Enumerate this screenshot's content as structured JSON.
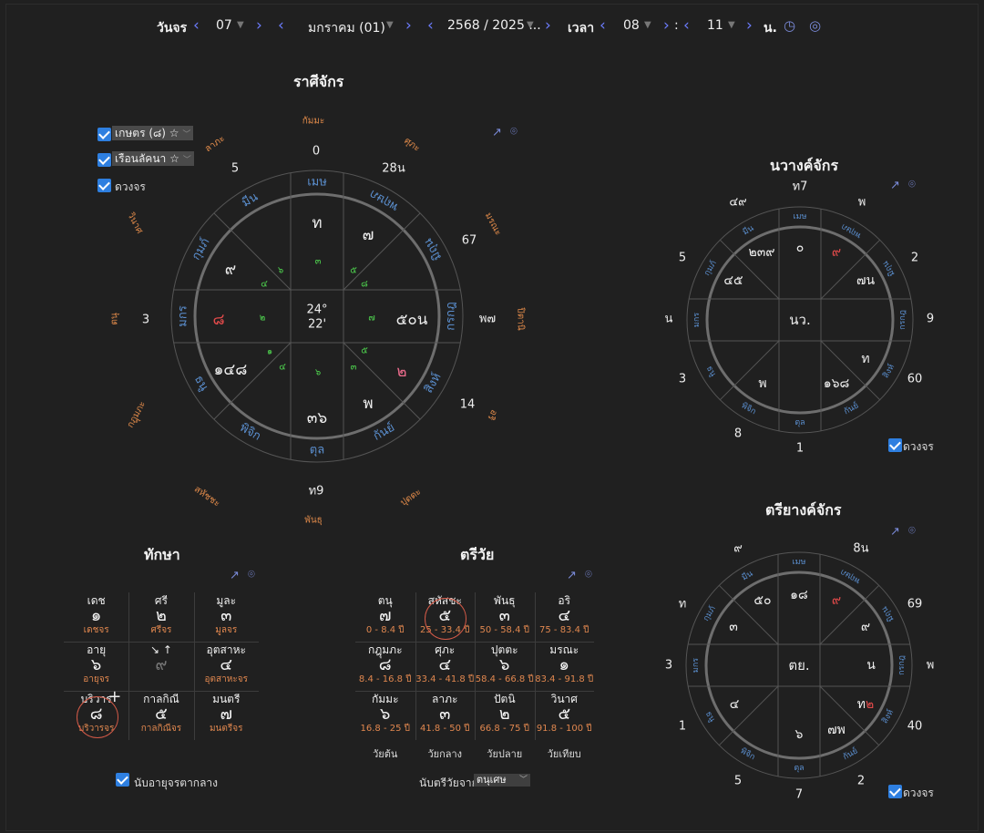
{
  "topbar": {
    "day_label": "วันจร",
    "day": "07",
    "month": "มกราคม (01)",
    "year": "2568 / 2025 ...",
    "time_label": "เวลา",
    "hour": "08",
    "colon": ":",
    "minute": "11",
    "unit": "น."
  },
  "rasi": {
    "title": "ราศีจักร",
    "checks": [
      {
        "label": "เกษตร (๘) ☆",
        "checked": true
      },
      {
        "label": "เรือนลัคนา ☆",
        "checked": true
      },
      {
        "label": "ดวงจร",
        "checked": true
      }
    ],
    "center": [
      "24°",
      "22'"
    ],
    "outer_labels": [
      "กัมมะ",
      "ศุภะ",
      "มรณะ",
      "ปิตานิ",
      "อริ",
      "ปุตตะ",
      "พันธุ",
      "สหัชชะ",
      "กฎุมภะ",
      "ตนุ",
      "วินาศ",
      "ลาภะ"
    ],
    "outer_numbers": [
      "0",
      "28น",
      "67",
      "พ๗",
      "14",
      "ท9",
      "3",
      "5"
    ],
    "signs": [
      "เมษ",
      "มีน",
      "กุมภ์",
      "มกร",
      "ธนู",
      "พิจิก",
      "ตุล",
      "กันย์",
      "สิงห์",
      "กรกฎ",
      "มิถุน",
      "พฤษภ"
    ],
    "planets": [
      "ท",
      "๗",
      "๕๐น",
      "๒",
      "พ",
      "๓๖",
      "๑๔๘",
      "๘",
      "๙"
    ],
    "small": [
      "๓",
      "๕",
      "๘",
      "๗",
      "๕",
      "๓",
      "๖",
      "๔",
      "๑",
      "๒",
      "๔",
      "๖"
    ]
  },
  "navang": {
    "title": "นวางค์จักร",
    "center": "นว.",
    "outer": [
      "ท7",
      "พ",
      "2",
      "9",
      "60",
      "1",
      "8",
      "3",
      "น",
      "5",
      "๔๙"
    ],
    "signs": [
      "เมษ",
      "มีน",
      "กุมภ์",
      "มกร",
      "ธนู",
      "พิจิก",
      "ตุล",
      "กันย์",
      "สิงห์",
      "กรกฎ",
      "มิถุน",
      "พฤษภ"
    ],
    "planets": [
      "๐",
      "๙",
      "๗น",
      "ท",
      "๑๖๘",
      "พ",
      "๔๕",
      "๒๓๙"
    ],
    "check": "ดวงจร"
  },
  "triyang": {
    "title": "ตรียางค์จักร",
    "center": "ตย.",
    "outer": [
      "8น",
      "69",
      "พ",
      "40",
      "2",
      "7",
      "5",
      "1",
      "3",
      "ท",
      "๙"
    ],
    "signs": [
      "เมษ",
      "มีน",
      "กุมภ์",
      "มกร",
      "ธนู",
      "พิจิก",
      "ตุล",
      "กันย์",
      "สิงห์",
      "กรกฎ",
      "มิถุน",
      "พฤษภ"
    ],
    "planets": [
      "๑๘",
      "๙",
      "๙",
      "น",
      "ท๒",
      "๗พ",
      "๖",
      "๔",
      "๓",
      "๕๐"
    ],
    "check": "ดวงจร"
  },
  "taksa": {
    "title": "ทักษา",
    "cells": [
      {
        "top": "เดช",
        "num": "๑",
        "sub": "เดชจร"
      },
      {
        "top": "ศรี",
        "num": "๒",
        "sub": "ศรีจร"
      },
      {
        "top": "มูละ",
        "num": "๓",
        "sub": "มูลจร"
      },
      {
        "top": "อายุ",
        "num": "๖",
        "sub": "อายุจร"
      },
      {
        "top": "↘ ↑",
        "num": "๙",
        "sub": ""
      },
      {
        "top": "อุตสาหะ",
        "num": "๔",
        "sub": "อุตสาหะจร"
      },
      {
        "top": "บริวาร",
        "num": "๘",
        "sub": "บริวารจร"
      },
      {
        "top": "กาลกิณี",
        "num": "๕",
        "sub": "กาลกิณีจร"
      },
      {
        "top": "มนตรี",
        "num": "๗",
        "sub": "มนตรีจร"
      }
    ],
    "footer": "นับอายุจรตากลาง"
  },
  "triwai": {
    "title": "ตรีวัย",
    "cells": [
      {
        "top": "ตนุ",
        "num": "๗",
        "sub": "0 - 8.4 ปี"
      },
      {
        "top": "สหัสชะ",
        "num": "๕",
        "sub": "25 - 33.4 ปี"
      },
      {
        "top": "พันธุ",
        "num": "๓",
        "sub": "50 - 58.4 ปี"
      },
      {
        "top": "อริ",
        "num": "๔",
        "sub": "75 - 83.4 ปี"
      },
      {
        "top": "กฎุมภะ",
        "num": "๘",
        "sub": "8.4 - 16.8 ปี"
      },
      {
        "top": "ศุภะ",
        "num": "๔",
        "sub": "33.4 - 41.8 ปี"
      },
      {
        "top": "ปุตตะ",
        "num": "๖",
        "sub": "58.4 - 66.8 ปี"
      },
      {
        "top": "มรณะ",
        "num": "๑",
        "sub": "83.4 - 91.8 ปี"
      },
      {
        "top": "กัมมะ",
        "num": "๖",
        "sub": "16.8 - 25 ปี"
      },
      {
        "top": "ลาภะ",
        "num": "๓",
        "sub": "41.8 - 50 ปี"
      },
      {
        "top": "ปัตนิ",
        "num": "๒",
        "sub": "66.8 - 75 ปี"
      },
      {
        "top": "วินาศ",
        "num": "๕",
        "sub": "91.8 - 100 ปี"
      }
    ],
    "cols": [
      "วัยต้น",
      "วัยกลาง",
      "วัยปลาย",
      "วัยเทียบ"
    ],
    "footer_label": "นับตรีวัยจาก",
    "footer_value": "ตนุเศษ"
  }
}
